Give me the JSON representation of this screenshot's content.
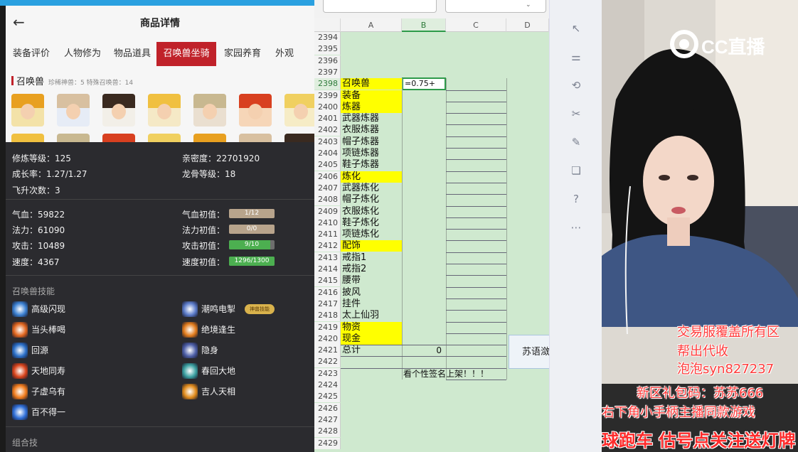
{
  "app_window_title": "",
  "left_panel": {
    "header": {
      "title": "商品详情",
      "back_icon": "arrow-left-icon"
    },
    "tabs": [
      "装备评价",
      "人物修为",
      "物品道具",
      "召唤兽坐骑",
      "家园养育",
      "外观"
    ],
    "active_tab": 3,
    "summon_section": {
      "title": "召唤兽",
      "sub": "珍稀神兽：5  特殊召唤兽：14"
    },
    "stats_top": [
      {
        "label": "修炼等级：125"
      },
      {
        "label": "亲密度：22701920"
      },
      {
        "label": "成长率：1.27/1.27"
      },
      {
        "label": "龙骨等级：18"
      },
      {
        "label": "飞升次数：3"
      }
    ],
    "stats_base": [
      {
        "label": "气血：59822"
      },
      {
        "label": "法力：61090"
      },
      {
        "label": "攻击：10489"
      },
      {
        "label": "速度：4367"
      }
    ],
    "stats_init": [
      {
        "label": "气血初值：",
        "value": "1/12",
        "fraction": 0.08,
        "color": "#b8a48c"
      },
      {
        "label": "法力初值：",
        "value": "0/0",
        "fraction": 0.0,
        "color": "#b8a48c"
      },
      {
        "label": "攻击初值：",
        "value": "9/10",
        "fraction": 0.9,
        "color": "#4caf50"
      },
      {
        "label": "速度初值：",
        "value": "1296/1300",
        "fraction": 0.997,
        "color": "#4caf50"
      }
    ],
    "skills_title": "召唤兽技能",
    "skills_left": [
      {
        "label": "高级闪现",
        "icon": "flash-skill-icon",
        "color": "#3a7fd0"
      },
      {
        "label": "当头棒喝",
        "icon": "club-skill-icon",
        "color": "#e0651d"
      },
      {
        "label": "回源",
        "icon": "return-skill-icon",
        "color": "#2a6fc8"
      },
      {
        "label": "天地同寿",
        "icon": "longevity-skill-icon",
        "color": "#d8431a"
      },
      {
        "label": "子虚乌有",
        "icon": "void-skill-icon",
        "color": "#f07a1a"
      },
      {
        "label": "百不得一",
        "icon": "rare-skill-icon",
        "color": "#2f6fd8"
      }
    ],
    "skills_right": [
      {
        "label": "潮鸣电掣",
        "icon": "thunder-skill-icon",
        "color": "#5a7ac8"
      },
      {
        "label": "绝境逢生",
        "icon": "revive-skill-icon",
        "color": "#e07a1a"
      },
      {
        "label": "隐身",
        "icon": "stealth-skill-icon",
        "color": "#4d5fa8"
      },
      {
        "label": "春回大地",
        "icon": "spring-skill-icon",
        "color": "#3aa0a0"
      },
      {
        "label": "吉人天相",
        "icon": "fortune-skill-icon",
        "color": "#e08a1a"
      }
    ],
    "skill_badge": "神兽技能",
    "combo_title": "组合技"
  },
  "spreadsheet": {
    "columns": [
      "A",
      "B",
      "C",
      "D"
    ],
    "selected_column": "B",
    "selected_row": 2398,
    "editing_cell_value": "=0.75+",
    "rows": [
      {
        "n": 2394,
        "a": "",
        "y": false
      },
      {
        "n": 2395,
        "a": "",
        "y": false
      },
      {
        "n": 2396,
        "a": "",
        "y": false
      },
      {
        "n": 2397,
        "a": "",
        "y": false
      },
      {
        "n": 2398,
        "a": "召唤兽",
        "y": true
      },
      {
        "n": 2399,
        "a": "装备",
        "y": true
      },
      {
        "n": 2400,
        "a": "炼器",
        "y": true
      },
      {
        "n": 2401,
        "a": "武器炼器",
        "y": false
      },
      {
        "n": 2402,
        "a": "衣服炼器",
        "y": false
      },
      {
        "n": 2403,
        "a": "帽子炼器",
        "y": false
      },
      {
        "n": 2404,
        "a": "项链炼器",
        "y": false
      },
      {
        "n": 2405,
        "a": "鞋子炼器",
        "y": false
      },
      {
        "n": 2406,
        "a": "炼化",
        "y": true
      },
      {
        "n": 2407,
        "a": "武器炼化",
        "y": false
      },
      {
        "n": 2408,
        "a": "帽子炼化",
        "y": false
      },
      {
        "n": 2409,
        "a": "衣服炼化",
        "y": false
      },
      {
        "n": 2410,
        "a": "鞋子炼化",
        "y": false
      },
      {
        "n": 2411,
        "a": "项链炼化",
        "y": false
      },
      {
        "n": 2412,
        "a": "配饰",
        "y": true
      },
      {
        "n": 2413,
        "a": "戒指1",
        "y": false
      },
      {
        "n": 2414,
        "a": "戒指2",
        "y": false
      },
      {
        "n": 2415,
        "a": "腰带",
        "y": false
      },
      {
        "n": 2416,
        "a": "披风",
        "y": false
      },
      {
        "n": 2417,
        "a": "挂件",
        "y": false
      },
      {
        "n": 2418,
        "a": "太上仙羽",
        "y": false
      },
      {
        "n": 2419,
        "a": "物资",
        "y": true
      },
      {
        "n": 2420,
        "a": "现金",
        "y": true
      },
      {
        "n": 2421,
        "a": "总计",
        "y": false,
        "b": "0"
      },
      {
        "n": 2422,
        "a": "",
        "y": false
      },
      {
        "n": 2423,
        "a": "",
        "y": false,
        "b": "看个性签名上架！！！"
      },
      {
        "n": 2424,
        "a": "",
        "y": false
      },
      {
        "n": 2425,
        "a": "",
        "y": false
      },
      {
        "n": 2426,
        "a": "",
        "y": false
      },
      {
        "n": 2427,
        "a": "",
        "y": false
      },
      {
        "n": 2428,
        "a": "",
        "y": false
      },
      {
        "n": 2429,
        "a": "",
        "y": false
      }
    ],
    "side_note": "苏语潋"
  },
  "toolbar_icons": [
    "cursor-icon",
    "sliders-icon",
    "rotate-icon",
    "tools-icon",
    "brush-icon",
    "bookmark-icon",
    "help-icon",
    "more-icon"
  ],
  "stream": {
    "logo_text": "CC直播",
    "overlay_lines": [
      "交易服覆盖所有区",
      "帮出代收",
      "泡泡syn827237",
      "新区礼包码：苏苏666",
      "右下角小手柄主播同款游戏"
    ],
    "bottom_line": "球跑车    估号点关注送灯牌 抽"
  }
}
